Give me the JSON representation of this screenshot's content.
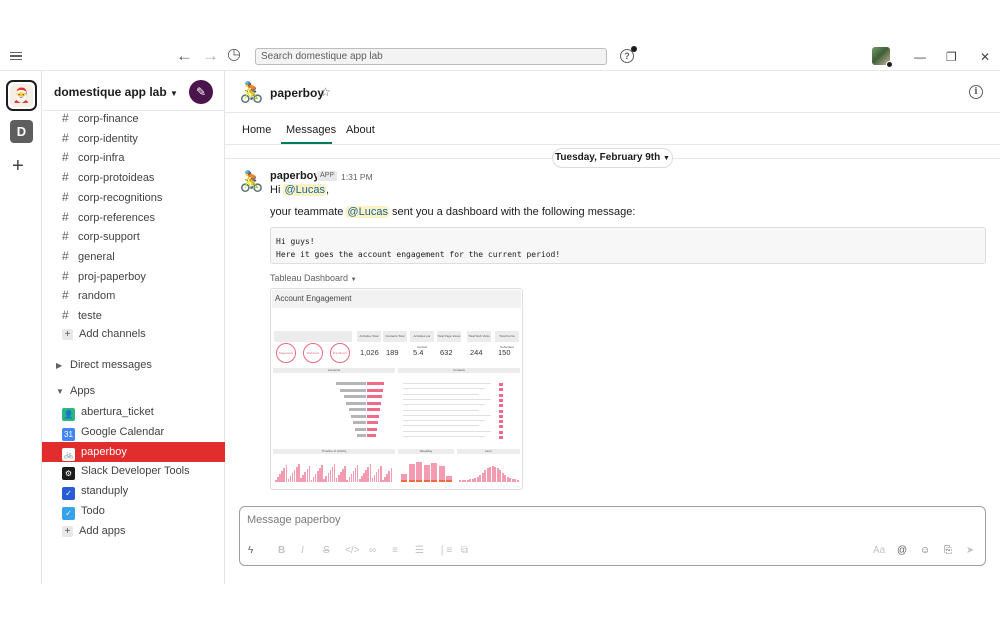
{
  "topbar": {
    "search_placeholder": "Search domestique app lab",
    "back": "←",
    "forward": "→",
    "history": "◷",
    "help": "?",
    "minimize": "—",
    "restore": "❐",
    "close": "✕"
  },
  "rail": {
    "workspace_initial": "D",
    "add": "+"
  },
  "sidebar": {
    "workspace_name": "domestique app lab",
    "channels": [
      "corp-finance",
      "corp-identity",
      "corp-infra",
      "corp-protoideas",
      "corp-recognitions",
      "corp-references",
      "corp-support",
      "general",
      "proj-paperboy",
      "random",
      "teste"
    ],
    "add_channels": "Add channels",
    "direct_messages": "Direct messages",
    "apps_label": "Apps",
    "apps": [
      {
        "name": "abertura_ticket",
        "icon": "person-icon",
        "color": "#2eb67d"
      },
      {
        "name": "Google Calendar",
        "icon": "calendar-icon",
        "color": "#4285f4"
      },
      {
        "name": "paperboy",
        "icon": "paperboy-icon",
        "color": "#ffffff"
      },
      {
        "name": "Slack Developer Tools",
        "icon": "gear-icon",
        "color": "#1d1c1d"
      },
      {
        "name": "standuply",
        "icon": "standuply-icon",
        "color": "#2a5bd7"
      },
      {
        "name": "Todo",
        "icon": "check-icon",
        "color": "#36a2eb"
      }
    ],
    "add_apps": "Add apps",
    "active_color": "#e22d2d"
  },
  "channel": {
    "name": "paperboy",
    "tabs": [
      "Home",
      "Messages",
      "About"
    ],
    "active_tab": "Messages"
  },
  "messages": {
    "date": "Tuesday, February 9th",
    "sender": "paperboy",
    "badge": "APP",
    "time": "1:31 PM",
    "greeting_prefix": "Hi ",
    "greeting_mention": "@Lucas",
    "greeting_suffix": ",",
    "line2_prefix": "your teammate ",
    "line2_mention": "@Lucas",
    "line2_suffix": " sent you a dashboard with the following message:",
    "code_line1": "Hi guys!",
    "code_line2": "Here it goes the account engagement for the current period!",
    "attachment_title": "Tableau Dashboard"
  },
  "dashboard": {
    "title": "Account Engagement",
    "kpi_labels": [
      "Activities Total",
      "Contacts Total",
      "Activities per Contact",
      "Total Page Views",
      "Total Web Visits",
      "Total Forms Submitted"
    ],
    "kpis": [
      "1,026",
      "189",
      "5.4",
      "632",
      "244",
      "150"
    ],
    "campaign_circles": [
      "Pageviews",
      "Webinars",
      "Enrollment"
    ],
    "panels": [
      "Accounts",
      "Contacts",
      "Timeline of Activity",
      "Weekday",
      "Hour"
    ]
  },
  "composer": {
    "placeholder": "Message paperboy"
  }
}
